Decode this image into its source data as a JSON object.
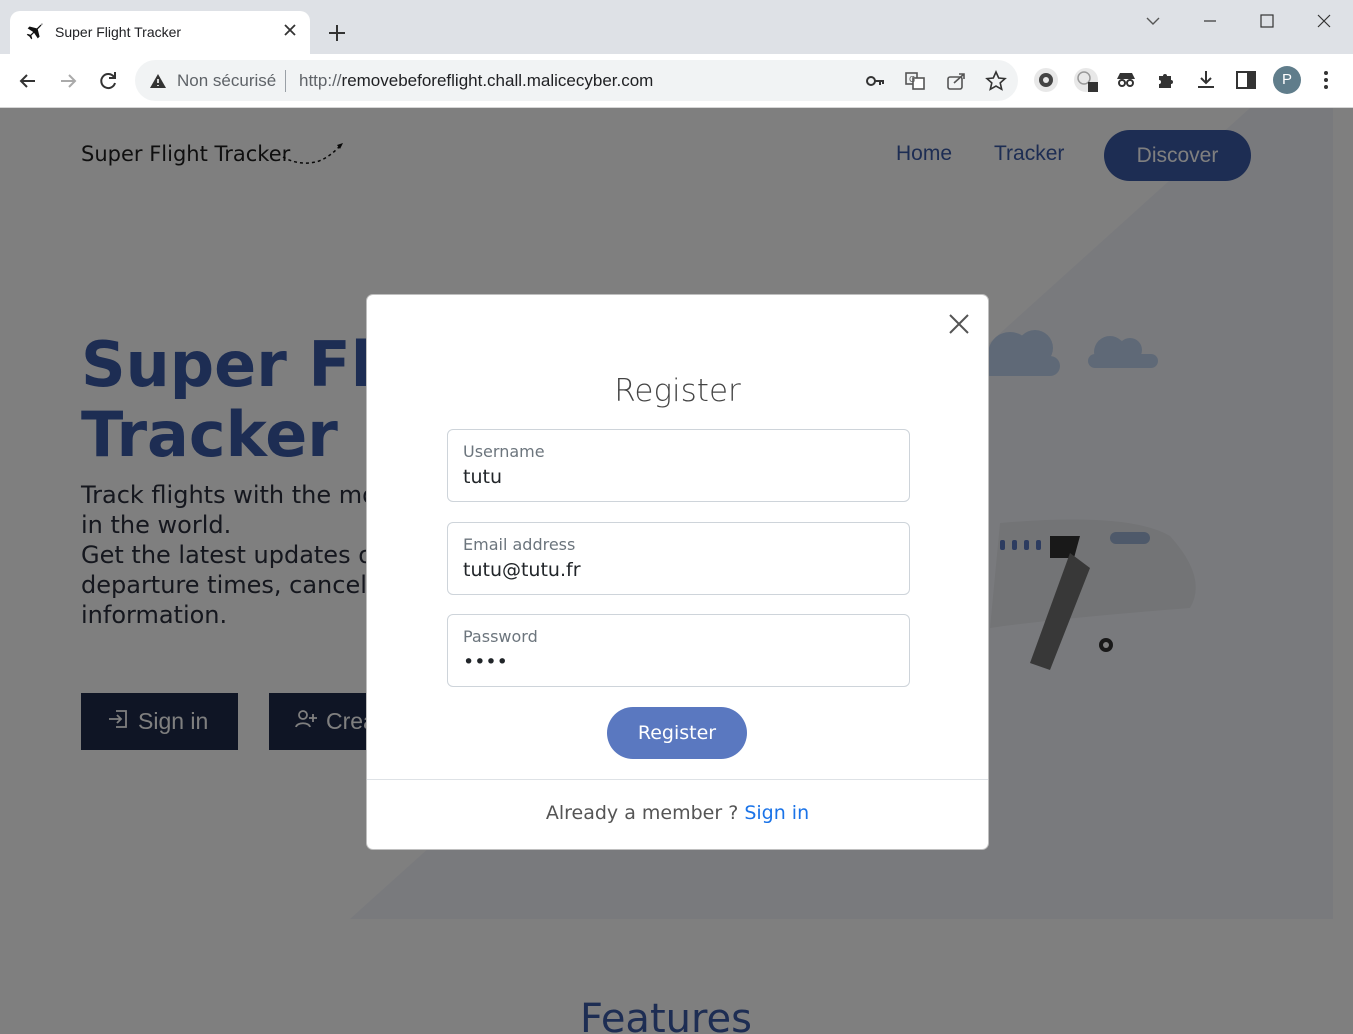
{
  "browser": {
    "tab_title": "Super Flight Tracker",
    "security_label": "Non sécurisé",
    "url_prefix": "http://",
    "url_host": "removebeforeflight.chall.malicecyber.com",
    "profile_initial": "P"
  },
  "site": {
    "brand": "Super Flight Tracker",
    "nav": {
      "home": "Home",
      "tracker": "Tracker",
      "discover": "Discover"
    },
    "hero_title_line1": "Super Flig",
    "hero_title_line2": "Tracker",
    "hero_text_lines": [
      "Track flights with the mo",
      "in the world.",
      "Get the latest updates or",
      "departure times, cancell",
      "information."
    ],
    "signin_button": "Sign in",
    "create_button": "Crea",
    "features_heading": "Features"
  },
  "modal": {
    "title": "Register",
    "username_label": "Username",
    "username_value": "tutu",
    "email_label": "Email address",
    "email_value": "tutu@tutu.fr",
    "password_label": "Password",
    "password_value": "tutu",
    "submit_label": "Register",
    "footer_text": "Already a member ?",
    "footer_link": "Sign in"
  }
}
